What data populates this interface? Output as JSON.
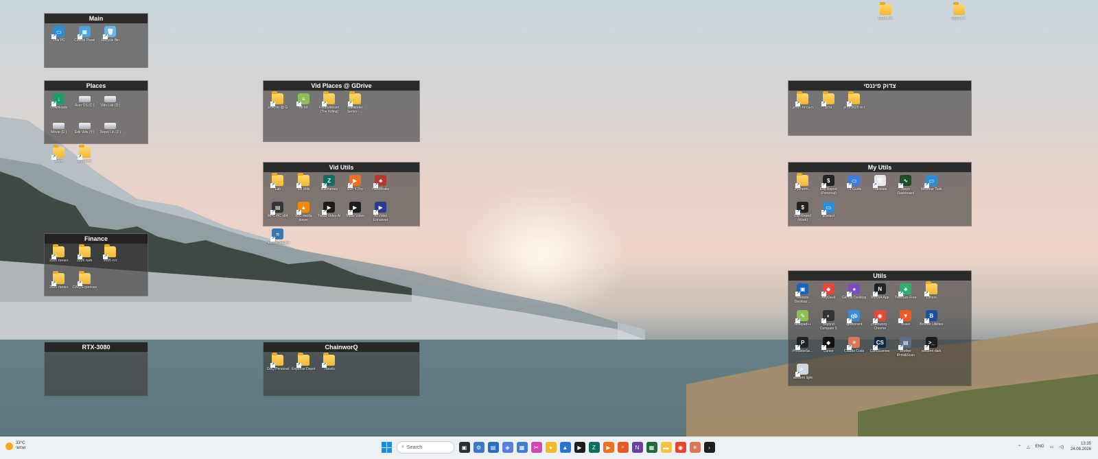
{
  "desktop": {
    "loose_icons": [
      {
        "label": "2024 תיק"
      },
      {
        "label": "2025 תיק"
      }
    ]
  },
  "fences": {
    "main": {
      "title": "Main",
      "items": [
        {
          "label": "This PC",
          "kind": "pc"
        },
        {
          "label": "Control Panel",
          "kind": "cp"
        },
        {
          "label": "Recycle Bin",
          "kind": "bin"
        }
      ]
    },
    "places": {
      "title": "Places",
      "items": [
        {
          "label": "Downloads",
          "kind": "dl"
        },
        {
          "label": "Acer OS (C:)",
          "kind": "drive"
        },
        {
          "label": "Vids Lab (D:)",
          "kind": "drive"
        },
        {
          "label": "Movie (E:)",
          "kind": "drive"
        },
        {
          "label": "Edit Vids (Y:)",
          "kind": "drive"
        },
        {
          "label": "Depot Lib (Z:)",
          "kind": "drive"
        },
        {
          "label": "Apps",
          "kind": "folder"
        },
        {
          "label": "My Drive",
          "kind": "folder"
        }
      ]
    },
    "finance": {
      "title": "Finance",
      "items": [
        {
          "label": "2026 הוצאות",
          "kind": "folder"
        },
        {
          "label": "2026 מעמ",
          "kind": "folder"
        },
        {
          "label": "2025 דוח",
          "kind": "folder"
        },
        {
          "label": "2025 הוצאות",
          "kind": "folder"
        },
        {
          "label": "CWQ Expenses",
          "kind": "folder"
        }
      ]
    },
    "rtx": {
      "title": "RTX-3080",
      "items": []
    },
    "vidplaces": {
      "title": "Vid Places @ GDrive",
      "items": [
        {
          "label": "סרטונים @ G",
          "kind": "folder"
        },
        {
          "label": "ldr.txt",
          "kind": "file"
        },
        {
          "label": "Forbrydelsen (The Killing)",
          "kind": "folder"
        },
        {
          "label": "Wallander Series - ...",
          "kind": "folder"
        }
      ]
    },
    "vidutils": {
      "title": "Vid Utils",
      "items": [
        {
          "label": "Lab",
          "kind": "folder"
        },
        {
          "label": "Vid Utils",
          "kind": "folder"
        },
        {
          "label": "flowframes",
          "kind": "ff"
        },
        {
          "label": "SVP 4 Pro",
          "kind": "svp"
        },
        {
          "label": "HandBrake",
          "kind": "hb"
        },
        {
          "label": "MPC-HC x64",
          "kind": "mpc"
        },
        {
          "label": "VLC media player",
          "kind": "vlc"
        },
        {
          "label": "Topaz Video AI",
          "kind": "topaz"
        },
        {
          "label": "Topaz Video",
          "kind": "topaz"
        },
        {
          "label": "AI Video Enhancer",
          "kind": "aive"
        },
        {
          "label": "Hebrew Subtitle ...",
          "kind": "py"
        }
      ]
    },
    "chainworq": {
      "title": "ChainworQ",
      "items": [
        {
          "label": "CwQ Personal",
          "kind": "folder"
        },
        {
          "label": "Expense Depot",
          "kind": "folder"
        },
        {
          "label": "Travels",
          "kind": "folder"
        }
      ]
    },
    "tzadok": {
      "title": "צדוק פיננסי",
      "items": [
        {
          "label": "העברות לצדוק",
          "kind": "folder"
        },
        {
          "label": "צדוק",
          "kind": "folder"
        },
        {
          "label": "דוח 2025 צדוק",
          "kind": "folder"
        }
      ]
    },
    "myutils": {
      "title": "My Utils",
      "items": [
        {
          "label": "Pycharm...",
          "kind": "folder"
        },
        {
          "label": "Exp Report (Personal)",
          "kind": "exp"
        },
        {
          "label": "TV Guide",
          "kind": "tv"
        },
        {
          "label": "Translate",
          "kind": "tr"
        },
        {
          "label": "Repo Dashboard",
          "kind": "repo"
        },
        {
          "label": "Mishmar Task",
          "kind": "pc"
        },
        {
          "label": "Exp Report (Work)",
          "kind": "exp"
        },
        {
          "label": "pcwiard",
          "kind": "pc"
        }
      ]
    },
    "utils": {
      "title": "Utils",
      "items": [
        {
          "label": "Remote Desktop ...",
          "kind": "rdp"
        },
        {
          "label": "AnyDesk",
          "kind": "anydesk"
        },
        {
          "label": "GitHub Desktop",
          "kind": "gh"
        },
        {
          "label": "NVIDIA App",
          "kind": "nv"
        },
        {
          "label": "TreeSize Free",
          "kind": "tree"
        },
        {
          "label": "Others",
          "kind": "folder"
        },
        {
          "label": "Notepad++",
          "kind": "npp"
        },
        {
          "label": "Beyond Compare 5",
          "kind": "bc"
        },
        {
          "label": "qBittorrent",
          "kind": "qb"
        },
        {
          "label": "chainworq - Chrome",
          "kind": "chrome"
        },
        {
          "label": "Brave",
          "kind": "brave"
        },
        {
          "label": "Brother Utilities",
          "kind": "bro"
        },
        {
          "label": "PredatorSe...",
          "kind": "pred"
        },
        {
          "label": "Cursor",
          "kind": "cursor"
        },
        {
          "label": "Claude Code",
          "kind": "claude"
        },
        {
          "label": "CamScanner",
          "kind": "cs"
        },
        {
          "label": "Brother iPrint&Scan",
          "kind": "bro2"
        },
        {
          "label": "winterm dark",
          "kind": "term"
        },
        {
          "label": "winterm light",
          "kind": "term2"
        }
      ]
    }
  },
  "taskbar": {
    "weather_temp": "33°C",
    "weather_text": "שמשי",
    "search_placeholder": "Search",
    "lang": "ENG",
    "time": "13:35",
    "date": "24.08.2026"
  },
  "icon_styles": {
    "pc": {
      "bg": "#2a8fd8",
      "g": "▭"
    },
    "cp": {
      "bg": "#4aa3df",
      "g": "▦"
    },
    "bin": {
      "bg": "#6fb4e6",
      "g": "🗑"
    },
    "dl": {
      "bg": "#1f9d6b",
      "g": "↓"
    },
    "file": {
      "bg": "#8bbf5a",
      "g": "≡"
    },
    "ff": {
      "bg": "#0f6e5f",
      "g": "Z"
    },
    "svp": {
      "bg": "#f07020",
      "g": "▶"
    },
    "hb": {
      "bg": "#b33b2b",
      "g": "♣"
    },
    "mpc": {
      "bg": "#333",
      "g": "▤"
    },
    "vlc": {
      "bg": "#f08a00",
      "g": "▲"
    },
    "topaz": {
      "bg": "#1c1c1c",
      "g": "▶"
    },
    "aive": {
      "bg": "#2a3c8f",
      "g": "▶"
    },
    "py": {
      "bg": "#3a78b0",
      "g": "≈"
    },
    "exp": {
      "bg": "#222",
      "g": "$"
    },
    "tv": {
      "bg": "#3b7ddd",
      "g": "▭"
    },
    "tr": {
      "bg": "#e8e8e8",
      "g": "文"
    },
    "repo": {
      "bg": "#1e4d2b",
      "g": "∿"
    },
    "rdp": {
      "bg": "#1565c0",
      "g": "▣"
    },
    "anydesk": {
      "bg": "#ef443b",
      "g": "◆"
    },
    "gh": {
      "bg": "#7c4dbf",
      "g": "●"
    },
    "nv": {
      "bg": "#222",
      "g": "N"
    },
    "tree": {
      "bg": "#2bb36b",
      "g": "♣"
    },
    "npp": {
      "bg": "#8dc152",
      "g": "✎"
    },
    "bc": {
      "bg": "#333",
      "g": "◐"
    },
    "qb": {
      "bg": "#3c8ad8",
      "g": "qb"
    },
    "chrome": {
      "bg": "#dd4b39",
      "g": "◉"
    },
    "brave": {
      "bg": "#f15a24",
      "g": "▼"
    },
    "bro": {
      "bg": "#1b4fa0",
      "g": "B"
    },
    "pred": {
      "bg": "#222",
      "g": "P"
    },
    "cursor": {
      "bg": "#111",
      "g": "◆"
    },
    "claude": {
      "bg": "#d97757",
      "g": "✳"
    },
    "cs": {
      "bg": "#0c2a3a",
      "g": "CS"
    },
    "bro2": {
      "bg": "#5b6e86",
      "g": "▤"
    },
    "term": {
      "bg": "#1e1e1e",
      "g": ">_"
    },
    "term2": {
      "bg": "#cfd6dd",
      "g": ">_"
    }
  }
}
